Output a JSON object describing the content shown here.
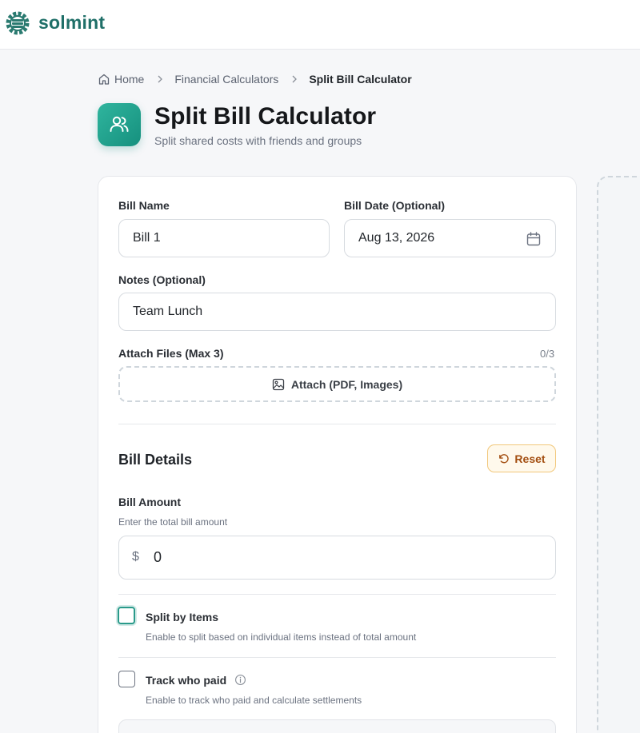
{
  "app": {
    "name": "solmint"
  },
  "breadcrumb": {
    "home": "Home",
    "section": "Financial Calculators",
    "current": "Split Bill Calculator"
  },
  "header": {
    "title": "Split Bill Calculator",
    "subtitle": "Split shared costs with friends and groups"
  },
  "form": {
    "bill_name": {
      "label": "Bill Name",
      "value": "Bill 1"
    },
    "bill_date": {
      "label": "Bill Date (Optional)",
      "value": "Aug 13, 2026"
    },
    "notes": {
      "label": "Notes (Optional)",
      "value": "Team Lunch"
    },
    "attach": {
      "label": "Attach Files (Max 3)",
      "count": "0/3",
      "button": "Attach (PDF, Images)"
    }
  },
  "bill_details": {
    "title": "Bill Details",
    "reset_label": "Reset",
    "amount": {
      "label": "Bill Amount",
      "hint": "Enter the total bill amount",
      "currency": "$",
      "value": "0"
    },
    "split_by_items": {
      "label": "Split by Items",
      "hint": "Enable to split based on individual items instead of total amount",
      "checked": false
    },
    "track_who_paid": {
      "label": "Track who paid",
      "hint": "Enable to track who paid and calculate settlements",
      "checked": false
    }
  },
  "colors": {
    "brand": "#1f6f68",
    "accent": "#2fb59e",
    "reset_border": "#f1c77a",
    "reset_text": "#a34e10"
  },
  "icons": {
    "logo": "gear-logo-icon",
    "home": "home-icon",
    "separator": "chevron-right-icon",
    "header": "users-icon",
    "calendar": "calendar-icon",
    "attach": "image-icon",
    "reset": "rotate-ccw-icon",
    "info": "info-icon"
  }
}
